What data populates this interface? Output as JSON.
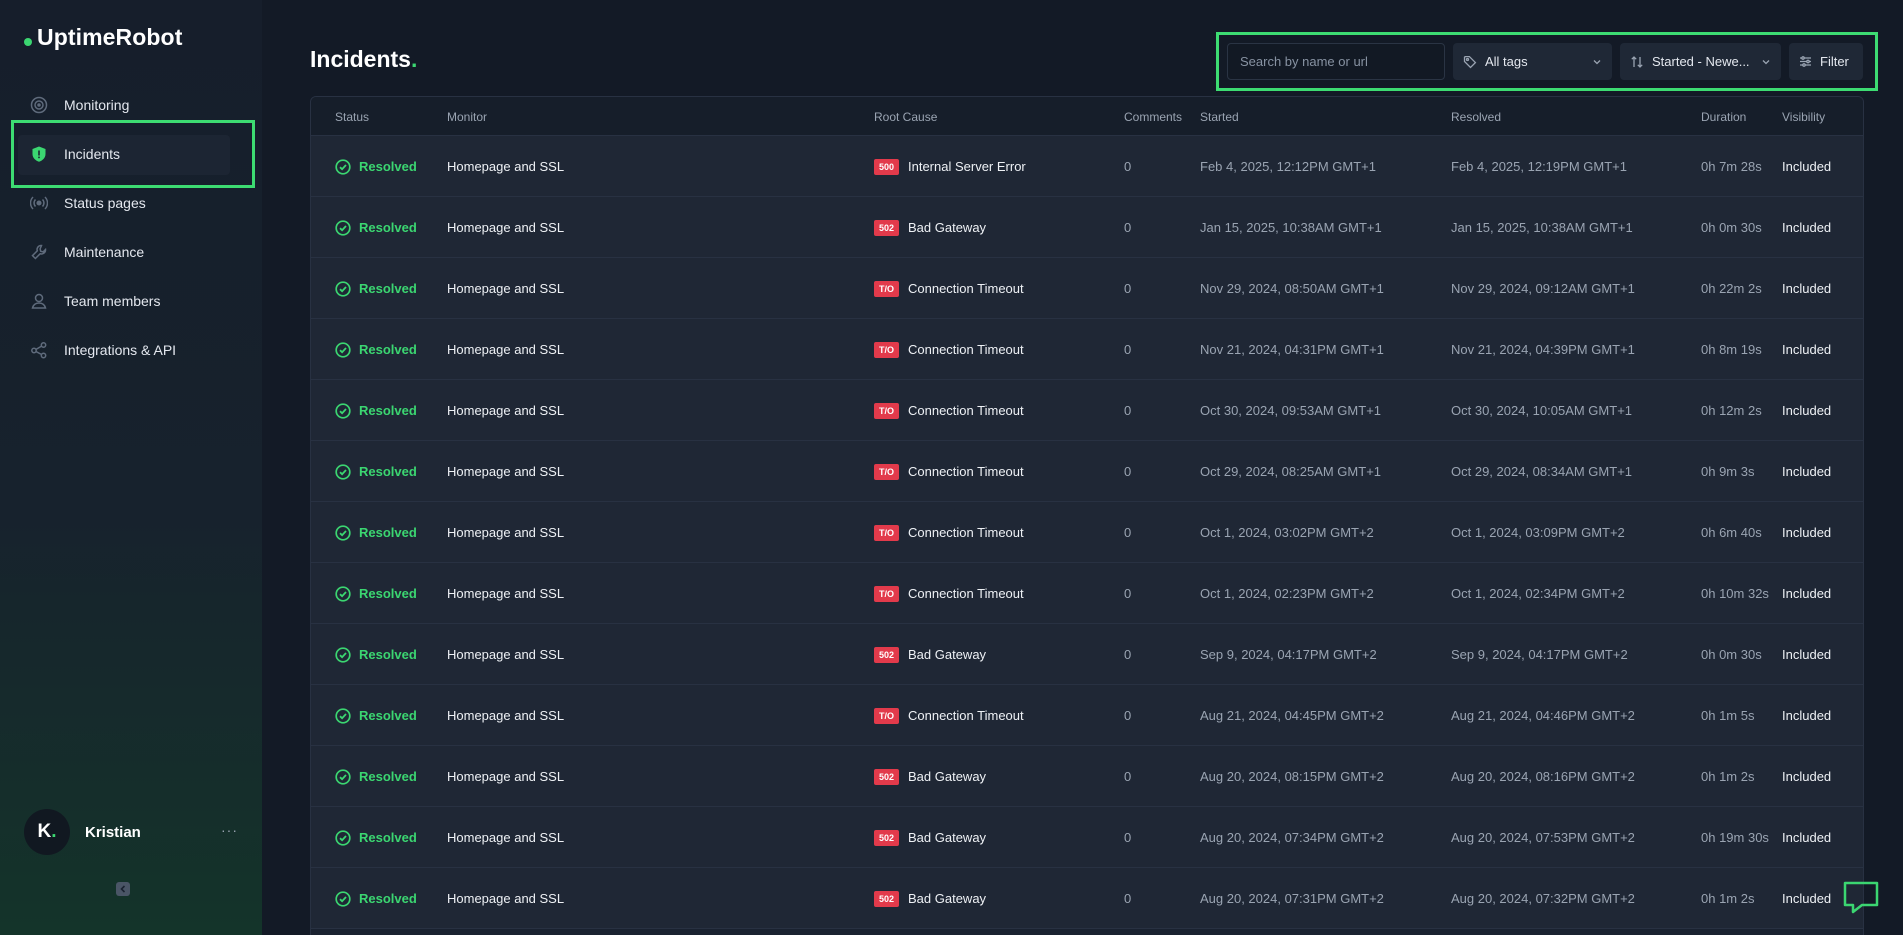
{
  "app": {
    "logo": "UptimeRobot",
    "accent": "#3bd671"
  },
  "sidebar": {
    "items": [
      {
        "label": "Monitoring",
        "icon": "monitoring-icon"
      },
      {
        "label": "Incidents",
        "icon": "shield-icon",
        "active": true
      },
      {
        "label": "Status pages",
        "icon": "broadcast-icon"
      },
      {
        "label": "Maintenance",
        "icon": "wrench-icon"
      },
      {
        "label": "Team members",
        "icon": "user-icon"
      },
      {
        "label": "Integrations & API",
        "icon": "share-nodes-icon"
      }
    ],
    "user": {
      "initial": "K",
      "name": "Kristian",
      "more": "···"
    }
  },
  "page": {
    "title": "Incidents"
  },
  "toolbar": {
    "search_placeholder": "Search by name or url",
    "tags_label": "All tags",
    "sort_label": "Started - Newe...",
    "filter_label": "Filter"
  },
  "table": {
    "headers": [
      "Status",
      "Monitor",
      "Root Cause",
      "Comments",
      "Started",
      "Resolved",
      "Duration",
      "Visibility"
    ],
    "rows": [
      {
        "status": "Resolved",
        "monitor": "Homepage and SSL",
        "code": "500",
        "cause": "Internal Server Error",
        "comments": "0",
        "started": "Feb 4, 2025, 12:12PM GMT+1",
        "resolved": "Feb 4, 2025, 12:19PM GMT+1",
        "duration": "0h 7m 28s",
        "visibility": "Included"
      },
      {
        "status": "Resolved",
        "monitor": "Homepage and SSL",
        "code": "502",
        "cause": "Bad Gateway",
        "comments": "0",
        "started": "Jan 15, 2025, 10:38AM GMT+1",
        "resolved": "Jan 15, 2025, 10:38AM GMT+1",
        "duration": "0h 0m 30s",
        "visibility": "Included"
      },
      {
        "status": "Resolved",
        "monitor": "Homepage and SSL",
        "code": "T/O",
        "cause": "Connection Timeout",
        "comments": "0",
        "started": "Nov 29, 2024, 08:50AM GMT+1",
        "resolved": "Nov 29, 2024, 09:12AM GMT+1",
        "duration": "0h 22m 2s",
        "visibility": "Included"
      },
      {
        "status": "Resolved",
        "monitor": "Homepage and SSL",
        "code": "T/O",
        "cause": "Connection Timeout",
        "comments": "0",
        "started": "Nov 21, 2024, 04:31PM GMT+1",
        "resolved": "Nov 21, 2024, 04:39PM GMT+1",
        "duration": "0h 8m 19s",
        "visibility": "Included"
      },
      {
        "status": "Resolved",
        "monitor": "Homepage and SSL",
        "code": "T/O",
        "cause": "Connection Timeout",
        "comments": "0",
        "started": "Oct 30, 2024, 09:53AM GMT+1",
        "resolved": "Oct 30, 2024, 10:05AM GMT+1",
        "duration": "0h 12m 2s",
        "visibility": "Included"
      },
      {
        "status": "Resolved",
        "monitor": "Homepage and SSL",
        "code": "T/O",
        "cause": "Connection Timeout",
        "comments": "0",
        "started": "Oct 29, 2024, 08:25AM GMT+1",
        "resolved": "Oct 29, 2024, 08:34AM GMT+1",
        "duration": "0h 9m 3s",
        "visibility": "Included"
      },
      {
        "status": "Resolved",
        "monitor": "Homepage and SSL",
        "code": "T/O",
        "cause": "Connection Timeout",
        "comments": "0",
        "started": "Oct 1, 2024, 03:02PM GMT+2",
        "resolved": "Oct 1, 2024, 03:09PM GMT+2",
        "duration": "0h 6m 40s",
        "visibility": "Included"
      },
      {
        "status": "Resolved",
        "monitor": "Homepage and SSL",
        "code": "T/O",
        "cause": "Connection Timeout",
        "comments": "0",
        "started": "Oct 1, 2024, 02:23PM GMT+2",
        "resolved": "Oct 1, 2024, 02:34PM GMT+2",
        "duration": "0h 10m 32s",
        "visibility": "Included"
      },
      {
        "status": "Resolved",
        "monitor": "Homepage and SSL",
        "code": "502",
        "cause": "Bad Gateway",
        "comments": "0",
        "started": "Sep 9, 2024, 04:17PM GMT+2",
        "resolved": "Sep 9, 2024, 04:17PM GMT+2",
        "duration": "0h 0m 30s",
        "visibility": "Included"
      },
      {
        "status": "Resolved",
        "monitor": "Homepage and SSL",
        "code": "T/O",
        "cause": "Connection Timeout",
        "comments": "0",
        "started": "Aug 21, 2024, 04:45PM GMT+2",
        "resolved": "Aug 21, 2024, 04:46PM GMT+2",
        "duration": "0h 1m 5s",
        "visibility": "Included"
      },
      {
        "status": "Resolved",
        "monitor": "Homepage and SSL",
        "code": "502",
        "cause": "Bad Gateway",
        "comments": "0",
        "started": "Aug 20, 2024, 08:15PM GMT+2",
        "resolved": "Aug 20, 2024, 08:16PM GMT+2",
        "duration": "0h 1m 2s",
        "visibility": "Included"
      },
      {
        "status": "Resolved",
        "monitor": "Homepage and SSL",
        "code": "502",
        "cause": "Bad Gateway",
        "comments": "0",
        "started": "Aug 20, 2024, 07:34PM GMT+2",
        "resolved": "Aug 20, 2024, 07:53PM GMT+2",
        "duration": "0h 19m 30s",
        "visibility": "Included"
      },
      {
        "status": "Resolved",
        "monitor": "Homepage and SSL",
        "code": "502",
        "cause": "Bad Gateway",
        "comments": "0",
        "started": "Aug 20, 2024, 07:31PM GMT+2",
        "resolved": "Aug 20, 2024, 07:32PM GMT+2",
        "duration": "0h 1m 2s",
        "visibility": "Included"
      }
    ]
  }
}
